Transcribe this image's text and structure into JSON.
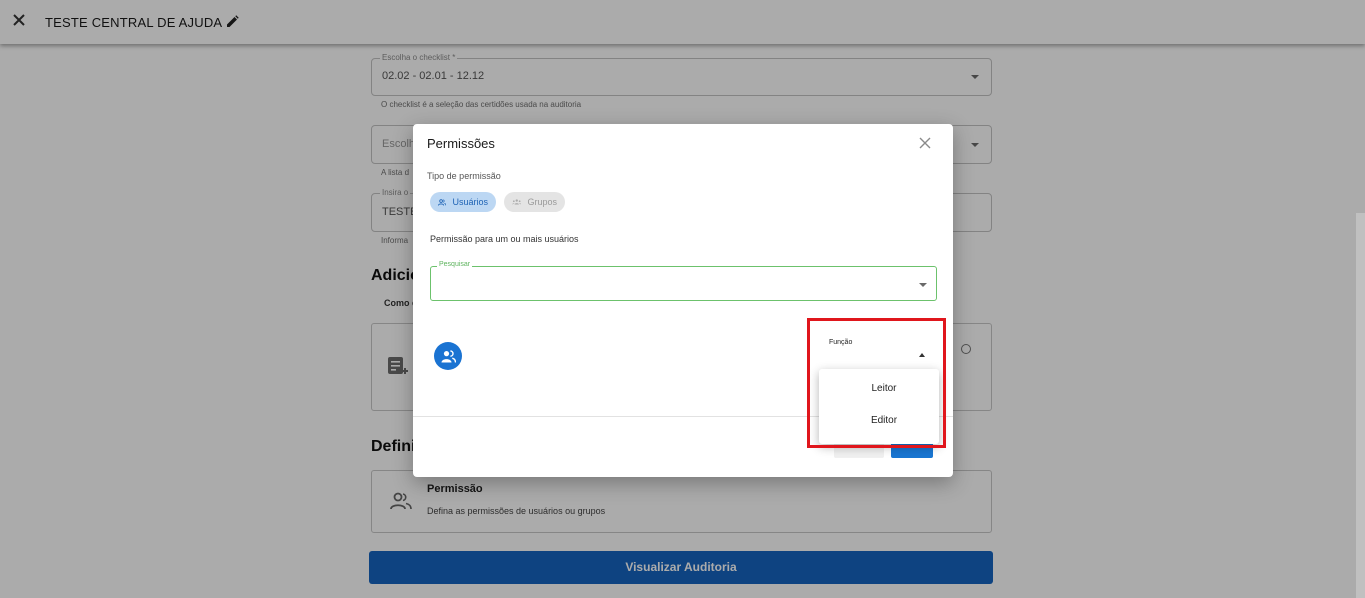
{
  "header": {
    "title": "TESTE CENTRAL DE AJUDA"
  },
  "form": {
    "checklist": {
      "legend": "Escolha o checklist *",
      "value": "02.02 - 02.01 - 12.12",
      "helper": "O checklist é a seleção das certidões usada na auditoria"
    },
    "field2": {
      "placeholder": "Escolh",
      "helper": "A lista d"
    },
    "field3": {
      "legend": "Insira o",
      "value": "TESTE",
      "helper": "Informa"
    },
    "section_add": {
      "title": "Adicio",
      "subtitle": "Como c"
    },
    "section_def": {
      "title": "Defini"
    },
    "permission_card": {
      "title": "Permissão",
      "description": "Defina as permissões de usuários ou grupos"
    },
    "view_button": "Visualizar Auditoria"
  },
  "modal": {
    "title": "Permissões",
    "type_label": "Tipo de permissão",
    "chips": [
      {
        "label": "Usuários",
        "selected": true
      },
      {
        "label": "Grupos",
        "selected": false
      }
    ],
    "description": "Permissão para um ou mais usuários",
    "search_legend": "Pesquisar",
    "function_label": "Função",
    "function_options": [
      "Leitor",
      "Editor"
    ]
  },
  "colors": {
    "primary": "#1565c0",
    "search_border": "#6cc26c",
    "highlight": "#e0161c"
  }
}
